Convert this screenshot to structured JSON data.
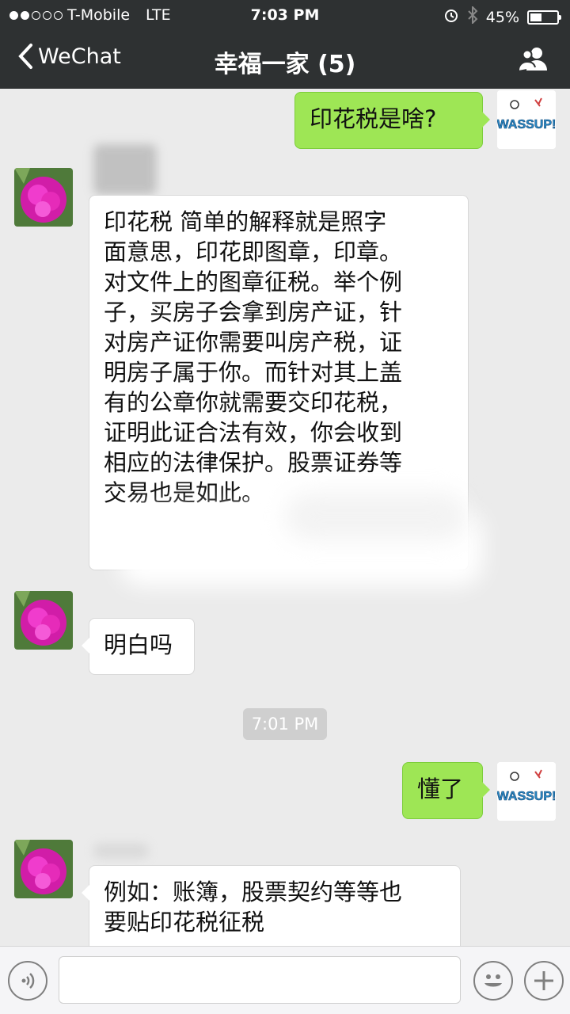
{
  "status": {
    "carrier": "T-Mobile",
    "network": "LTE",
    "time": "7:03 PM",
    "battery": "45%",
    "battery_level": 0.45
  },
  "nav": {
    "back_label": "WeChat",
    "title": "幸福一家 (5)"
  },
  "messages": [
    {
      "from": "me",
      "text": "印花税是啥?"
    },
    {
      "from": "other",
      "lines": [
        "印花税 简单的解释就是照字",
        "面意思，印花即图章，印章。",
        "对文件上的图章征税。举个例",
        "子，买房子会拿到房产证，针",
        "对房产证你需要叫房产税，证",
        "明房子属于你。而针对其上盖",
        "有的公章你就需要交印花税，",
        "证明此证合法有效，你会收到",
        "相应的法律保护。股票证券等",
        "交易也是如此。"
      ]
    },
    {
      "from": "other",
      "text": "明白吗"
    },
    {
      "from": "me",
      "text": "懂了"
    },
    {
      "from": "other",
      "lines": [
        "例如：账簿，股票契约等等也",
        "要贴印花税征税"
      ]
    }
  ],
  "timestamp": "7:01 PM",
  "sticker_text": "WASSUP!",
  "input": {
    "placeholder": ""
  },
  "colors": {
    "sent_bubble": "#9ee655",
    "header": "#2e3132",
    "background": "#ebebeb"
  }
}
